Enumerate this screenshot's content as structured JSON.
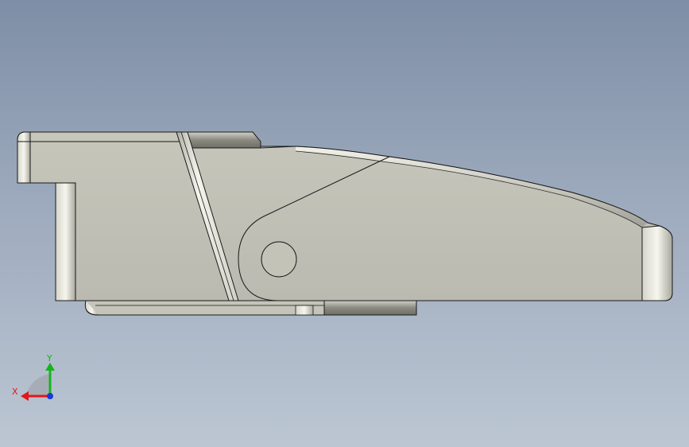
{
  "viewport": {
    "background_top": "#7e8ea6",
    "background_bottom": "#bcc6d3"
  },
  "model": {
    "body_color": "#c1c1b5",
    "edge_color": "#1a1a1a"
  },
  "triad": {
    "x_label": "X",
    "y_label": "Y",
    "x_color": "#e01818",
    "y_color": "#16b41e",
    "z_color": "#1a38d8"
  }
}
